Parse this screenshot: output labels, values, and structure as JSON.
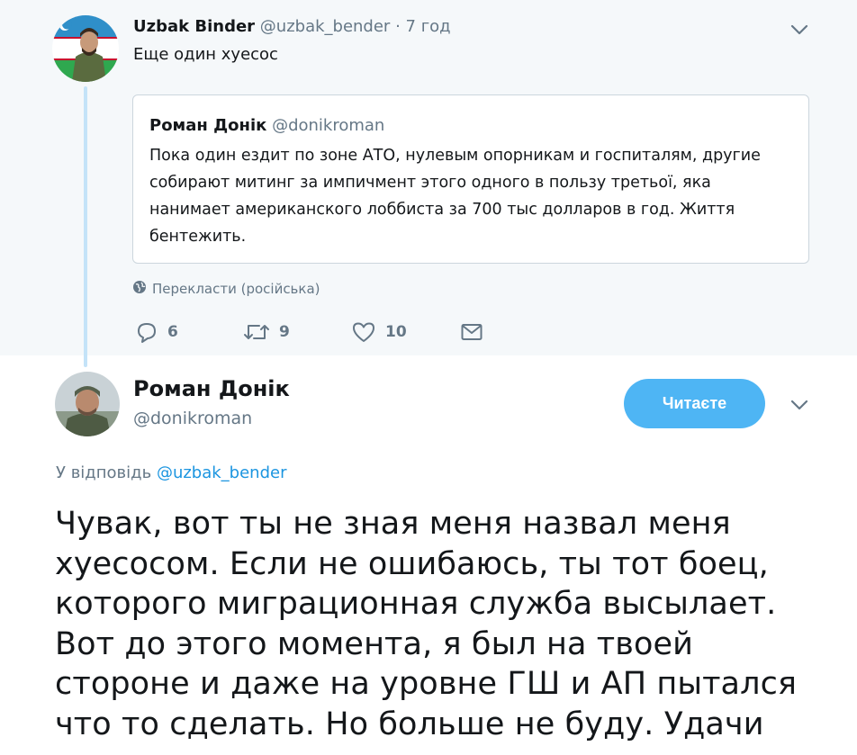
{
  "parent_tweet": {
    "author_name": "Uzbak Binder",
    "author_handle": "@uzbak_bender",
    "separator": "·",
    "time": "7 год",
    "text": "Еще один хуесос",
    "quoted": {
      "author_name": "Роман Донік",
      "author_handle": "@donikroman",
      "text": "Пока один ездит по зоне АТО, нулевым опорникам и госпиталям, другие собирают митинг за импичмент этого одного в пользу третьої, яка нанимает американского лоббиста за 700 тыс долларов в год. Життя бентежить."
    },
    "translate_label": "Перекласти (російська)",
    "actions": {
      "reply_count": "6",
      "retweet_count": "9",
      "like_count": "10"
    }
  },
  "main_tweet": {
    "author_name": "Роман Донік",
    "author_handle": "@donikroman",
    "follow_label": "Читаєте",
    "reply_prefix": "У відповідь",
    "reply_mention": "@uzbak_bender",
    "text": "Чувак, вот ты не зная меня назвал меня хуесосом. Если не ошибаюсь, ты тот боец, которого миграционная служба высылает. Вот до этого момента, я был на твоей стороне и даже на уровне ГШ и АП пытался что то сделать. Но больше не буду. Удачи"
  },
  "colors": {
    "accent": "#1da1f2",
    "muted": "#657786",
    "parent_bg": "#f5f8fa",
    "thread_line": "#c4e3f8"
  },
  "icons": [
    "chevron-down-icon",
    "globe-icon",
    "reply-icon",
    "retweet-icon",
    "like-icon",
    "message-icon"
  ]
}
